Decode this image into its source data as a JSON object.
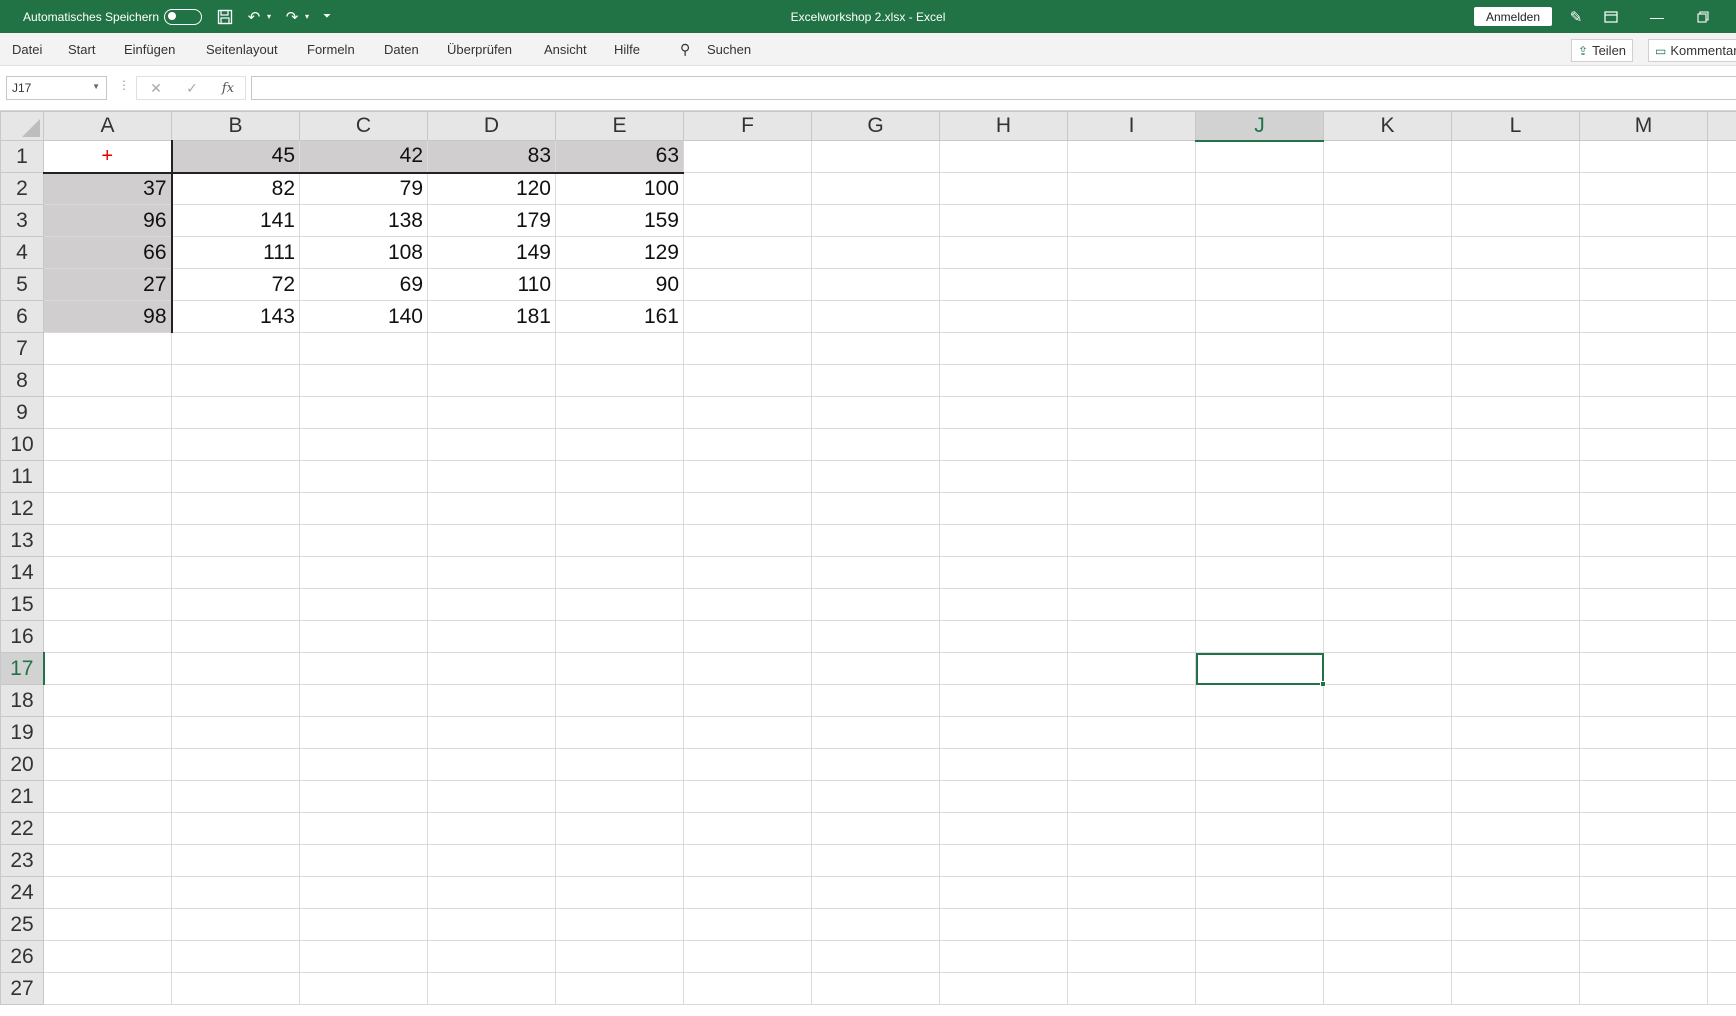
{
  "titlebar": {
    "autosave_label": "Automatisches Speichern",
    "doc_title": "Excelworkshop 2.xlsx  -  Excel",
    "signin_label": "Anmelden"
  },
  "menu": {
    "items": [
      "Datei",
      "Start",
      "Einfügen",
      "Seitenlayout",
      "Formeln",
      "Daten",
      "Überprüfen",
      "Ansicht",
      "Hilfe"
    ],
    "search_label": "Suchen",
    "share_label": "Teilen",
    "comments_label": "Kommentare"
  },
  "formulabar": {
    "namebox_value": "J17",
    "formula_value": ""
  },
  "sheet": {
    "columns": [
      "A",
      "B",
      "C",
      "D",
      "E",
      "F",
      "G",
      "H",
      "I",
      "J",
      "K",
      "L",
      "M"
    ],
    "active_cell": "J17",
    "cells": {
      "r1": [
        "+",
        "45",
        "42",
        "83",
        "63"
      ],
      "r2": [
        "37",
        "82",
        "79",
        "120",
        "100"
      ],
      "r3": [
        "96",
        "141",
        "138",
        "179",
        "159"
      ],
      "r4": [
        "66",
        "111",
        "108",
        "149",
        "129"
      ],
      "r5": [
        "27",
        "72",
        "69",
        "110",
        "90"
      ],
      "r6": [
        "98",
        "143",
        "140",
        "181",
        "161"
      ]
    },
    "accent_color": "#217346",
    "header_fill_color": "#d0cece",
    "operator_color": "#e00000"
  }
}
